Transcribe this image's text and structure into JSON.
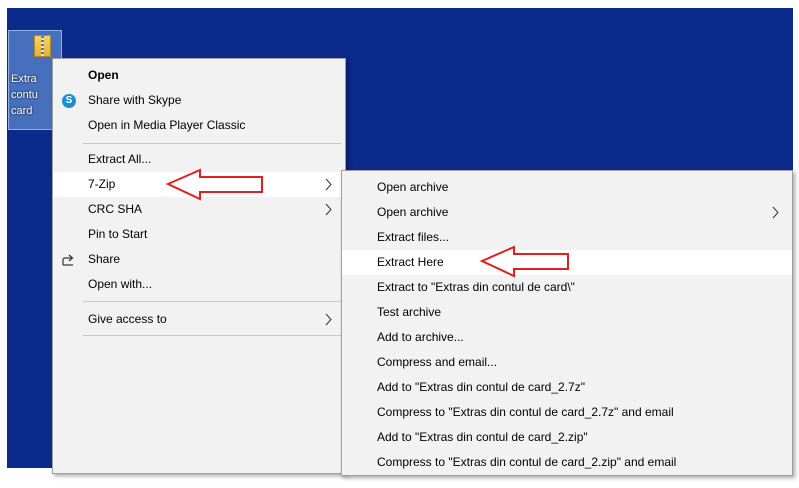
{
  "desktop_icon": {
    "label_lines": "Extra\ncontu\ncard"
  },
  "context_menu": {
    "items": [
      {
        "label": "Open"
      },
      {
        "label": "Share with Skype",
        "icon": "skype-icon"
      },
      {
        "label": "Open in Media Player Classic"
      },
      {
        "label": "Extract All..."
      },
      {
        "label": "7-Zip"
      },
      {
        "label": "CRC SHA"
      },
      {
        "label": "Pin to Start"
      },
      {
        "label": "Share",
        "icon": "share-icon"
      },
      {
        "label": "Open with..."
      },
      {
        "label": "Give access to"
      }
    ]
  },
  "submenu": {
    "items": [
      {
        "label": "Open archive"
      },
      {
        "label": "Open archive"
      },
      {
        "label": "Extract files..."
      },
      {
        "label": "Extract Here"
      },
      {
        "label": "Extract to \"Extras din contul de card\\\""
      },
      {
        "label": "Test archive"
      },
      {
        "label": "Add to archive..."
      },
      {
        "label": "Compress and email..."
      },
      {
        "label": "Add to \"Extras din contul de card_2.7z\""
      },
      {
        "label": "Compress to \"Extras din contul de card_2.7z\" and email"
      },
      {
        "label": "Add to \"Extras din contul de card_2.zip\""
      },
      {
        "label": "Compress to \"Extras din contul de card_2.zip\" and email"
      }
    ]
  },
  "colors": {
    "desktop": "#0a2a8c",
    "menu_bg": "#f2f2f2",
    "highlight": "#ffffff",
    "annotation_arrow": "#e02020"
  },
  "skype_glyph": "S"
}
